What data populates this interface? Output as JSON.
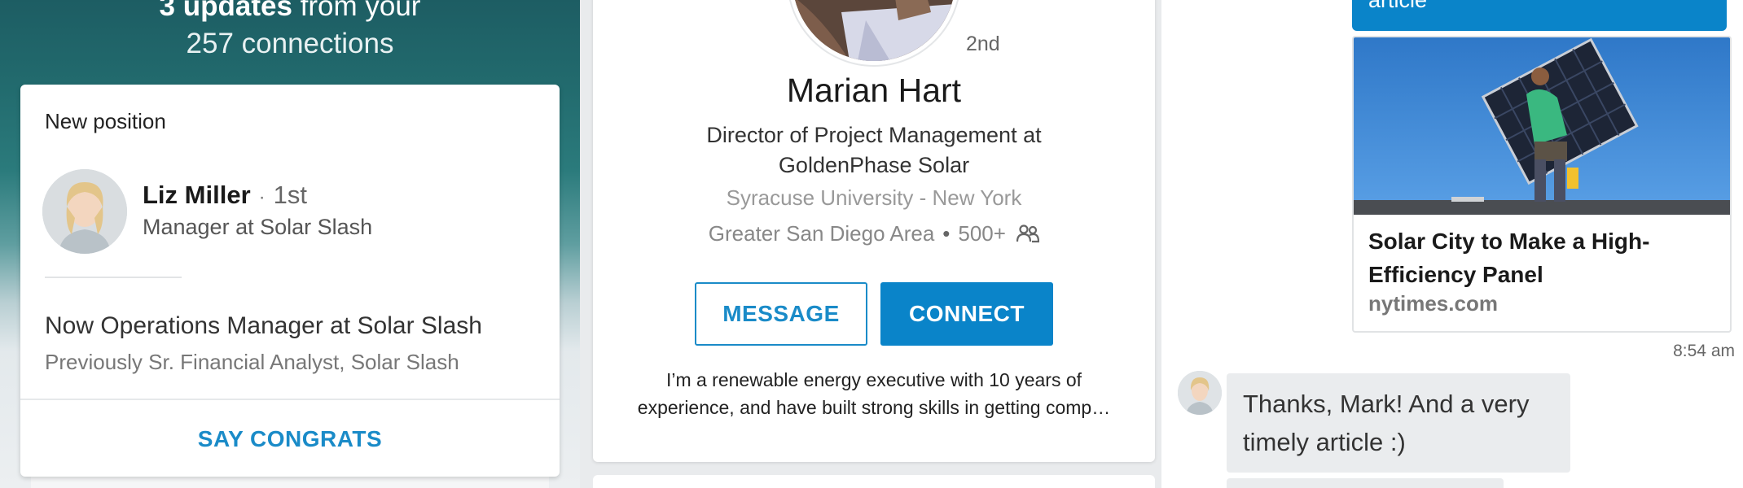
{
  "panel_updates": {
    "headline_bold": "3 updates",
    "headline_rest": " from your",
    "headline_line2": "257 connections",
    "card": {
      "section_label": "New position",
      "person_name": "Liz Miller",
      "separator": "·",
      "person_degree": "1st",
      "person_title": "Manager at Solar Slash",
      "update_headline": "Now Operations Manager at Solar Slash",
      "update_previous": "Previously Sr. Financial Analyst, Solar Slash",
      "action_label": "SAY CONGRATS"
    }
  },
  "panel_profile": {
    "degree": "2nd",
    "name": "Marian Hart",
    "title_line1": "Director of Project Management at",
    "title_line2": "GoldenPhase Solar",
    "school": "Syracuse University - New York",
    "location": "Greater San Diego Area",
    "dot": "•",
    "connections": "500+",
    "connections_icon": "people-icon",
    "message_label": "MESSAGE",
    "connect_label": "CONNECT",
    "bio_line1": "I’m a renewable energy executive with 10 years of",
    "bio_line2": "experience, and have built strong skills in getting comp…"
  },
  "panel_messages": {
    "sent_bubble_fragment": "article",
    "article_title": "Solar City to Make a High-Efficiency Panel",
    "article_source": "nytimes.com",
    "timestamp": "8:54 am",
    "reply_text": "Thanks, Mark! And a very timely article :)"
  },
  "colors": {
    "accent_blue": "#0a84c9",
    "link_blue": "#1a8bc8",
    "teal_header": "#226b6e"
  }
}
